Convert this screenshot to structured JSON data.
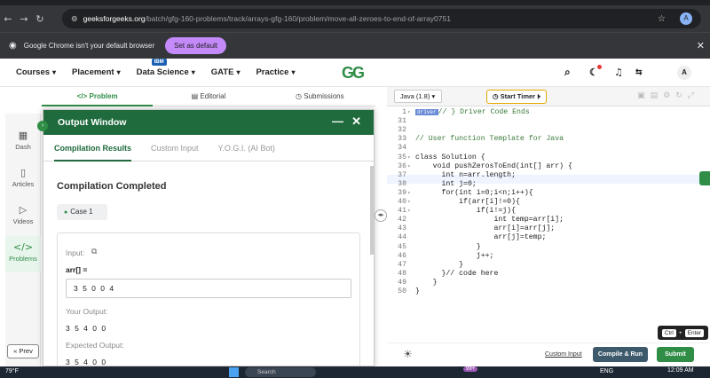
{
  "browser": {
    "url_host": "geeksforgeeks.org",
    "url_path": "/batch/gfg-160-problems/track/arrays-gfg-160/problem/move-all-zeroes-to-end-of-array0751",
    "infobar_text": "Google Chrome isn't your default browser",
    "set_default_label": "Set as default",
    "profile_initial": "A"
  },
  "site_nav": {
    "items": [
      "Courses",
      "Placement",
      "Data Science",
      "GATE",
      "Practice"
    ],
    "ibm_badge": "IBM",
    "logo": "GG",
    "avatar_initial": "A"
  },
  "problem_tabs": [
    "Problem",
    "Editorial",
    "Submissions"
  ],
  "rail": {
    "items": [
      "Dash",
      "Articles",
      "Videos",
      "Problems"
    ],
    "prev_label": "« Prev"
  },
  "output_window": {
    "title": "Output Window",
    "tabs": [
      "Compilation Results",
      "Custom Input",
      "Y.O.G.I. (AI Bot)"
    ],
    "status": "Compilation Completed",
    "case_label": "Case 1",
    "input_label": "Input:",
    "array_label": "arr[] =",
    "input_value": "3 5 0 0 4",
    "your_output_label": "Your Output:",
    "your_output_value": "3 5 4 0 0",
    "expected_output_label": "Expected Output:",
    "expected_output_value": "3 5 4 0 0"
  },
  "editor": {
    "language": "Java (1.8)",
    "timer_label": "Start Timer",
    "driver_tag": "driver",
    "lines": [
      {
        "n": "1",
        "text": "// } Driver Code Ends"
      },
      {
        "n": "31",
        "text": ""
      },
      {
        "n": "32",
        "text": ""
      },
      {
        "n": "33",
        "text": "// User function Template for Java"
      },
      {
        "n": "34",
        "text": ""
      },
      {
        "n": "35",
        "text": "class Solution {"
      },
      {
        "n": "36",
        "text": "    void pushZerosToEnd(int[] arr) {"
      },
      {
        "n": "37",
        "text": "      int n=arr.length;"
      },
      {
        "n": "38",
        "text": "      int j=0;"
      },
      {
        "n": "39",
        "text": "      for(int i=0;i<n;i++){"
      },
      {
        "n": "40",
        "text": "          if(arr[i]!=0){"
      },
      {
        "n": "41",
        "text": "              if(i!=j){"
      },
      {
        "n": "42",
        "text": "                  int temp=arr[i];"
      },
      {
        "n": "43",
        "text": "                  arr[i]=arr[j];"
      },
      {
        "n": "44",
        "text": "                  arr[j]=temp;"
      },
      {
        "n": "45",
        "text": "              }"
      },
      {
        "n": "46",
        "text": "              j++;"
      },
      {
        "n": "47",
        "text": "          }"
      },
      {
        "n": "48",
        "text": "      }// code here"
      },
      {
        "n": "49",
        "text": "    }"
      },
      {
        "n": "50",
        "text": "}"
      }
    ],
    "custom_input_label": "Custom Input",
    "compile_label": "Compile & Run",
    "submit_label": "Submit",
    "kbd_ctrl": "Ctrl",
    "kbd_plus": "+",
    "kbd_enter": "Enter"
  },
  "taskbar": {
    "weather": "79°F",
    "search_placeholder": "Search",
    "badge": "99+",
    "lang": "ENG",
    "time": "12:09 AM"
  }
}
